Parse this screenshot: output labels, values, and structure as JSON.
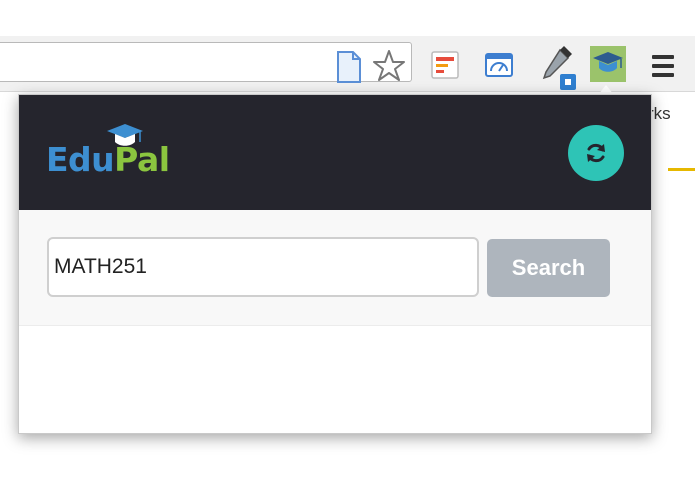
{
  "browser": {
    "bookmarks_partial": "rks",
    "icons": [
      "page-icon",
      "star-icon",
      "extension-icon",
      "gauge-icon",
      "color-picker-icon",
      "edupal-extension-icon",
      "menu-icon"
    ]
  },
  "popup": {
    "logo": {
      "part1": "Edu",
      "part2": "Pal"
    },
    "search": {
      "value": "MATH251",
      "placeholder": ""
    },
    "search_button_label": "Search",
    "refresh_icon": "refresh-icon"
  },
  "colors": {
    "header_bg": "#25252d",
    "logo_edu": "#3d8fd1",
    "logo_pal": "#8bc53f",
    "refresh_bg": "#2ec4b6",
    "button_bg": "#aeb5bd"
  }
}
